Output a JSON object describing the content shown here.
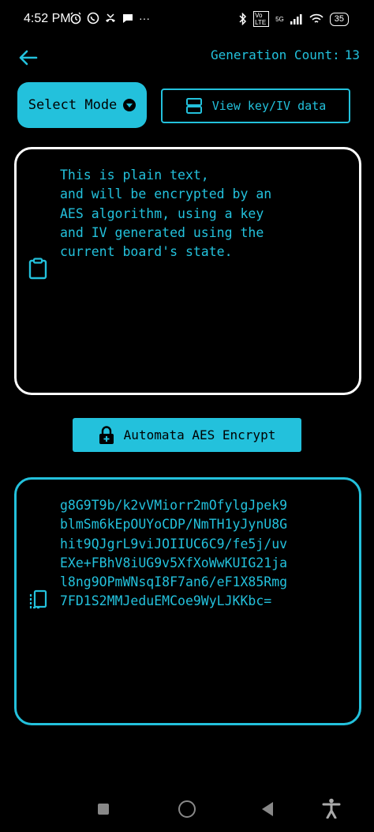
{
  "status_bar": {
    "time": "4:52 PM",
    "left_icons": [
      "alarm-icon",
      "whatsapp-icon",
      "missed-call-icon",
      "chat-icon",
      "more-icon"
    ],
    "more": "···",
    "volte": "Vo LTE",
    "network": "5G",
    "battery": "35"
  },
  "header": {
    "generation_label": "Generation Count:",
    "generation_value": "13"
  },
  "toolbar": {
    "select_mode_label": "Select Mode",
    "view_key_label": "View key/IV data"
  },
  "plain_text": {
    "lines": [
      "This is plain text,",
      "and will be encrypted by an",
      "AES algorithm, using a key",
      "and IV generated using the",
      "current board's state."
    ]
  },
  "encrypt_button": {
    "label": "Automata AES Encrypt"
  },
  "cipher_text": {
    "lines": [
      "g8G9T9b/k2vVMiorr2mOfylgJpek9",
      "blmSm6kEpOUYoCDP/NmTH1yJynU8G",
      "hit9QJgrL9viJOIIUC6C9/fe5j/uv",
      "EXe+FBhV8iUG9v5XfXoWwKUIG21ja",
      "l8ng9OPmWNsqI8F7an6/eF1X85Rmg",
      "7FD1S2MMJeduEMCoe9WyLJKKbc="
    ]
  },
  "colors": {
    "accent": "#23c1dc",
    "background": "#000000",
    "input_border": "#ffffff"
  }
}
